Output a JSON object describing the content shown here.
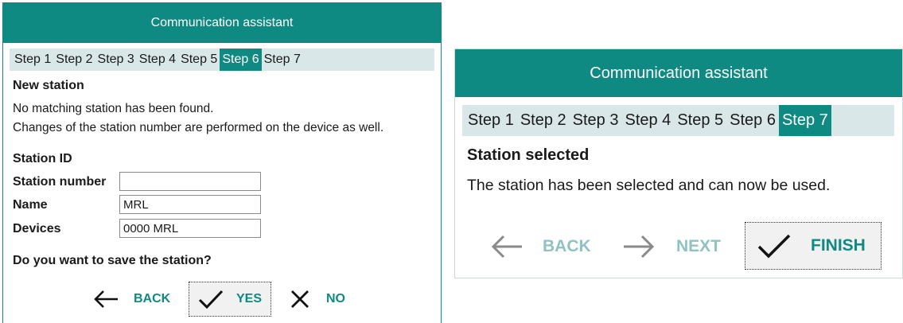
{
  "dialog1": {
    "title": "Communication assistant",
    "steps": [
      "Step 1",
      "Step 2",
      "Step 3",
      "Step 4",
      "Step 5",
      "Step 6",
      "Step 7"
    ],
    "active_step": "Step 6",
    "heading": "New station",
    "line1": "No matching station has been found.",
    "line2": "Changes of the station number are performed on the device as well.",
    "station_id_label": "Station ID",
    "fields": {
      "station_number_label": "Station number",
      "station_number_value": "",
      "name_label": "Name",
      "name_value": "MRL",
      "devices_label": "Devices",
      "devices_value": "0000 MRL"
    },
    "question": "Do you want to save the station?",
    "buttons": {
      "back": "BACK",
      "yes": "YES",
      "no": "NO"
    }
  },
  "dialog2": {
    "title": "Communication assistant",
    "steps": [
      "Step 1",
      "Step 2",
      "Step 3",
      "Step 4",
      "Step 5",
      "Step 6",
      "Step 7"
    ],
    "active_step": "Step 7",
    "heading": "Station selected",
    "message": "The station has been selected and can now be used.",
    "buttons": {
      "back": "BACK",
      "next": "NEXT",
      "finish": "FINISH"
    }
  },
  "colors": {
    "accent": "#0f8a83",
    "step_bar": "#d9e7e9",
    "disabled": "#8ec3c0"
  }
}
